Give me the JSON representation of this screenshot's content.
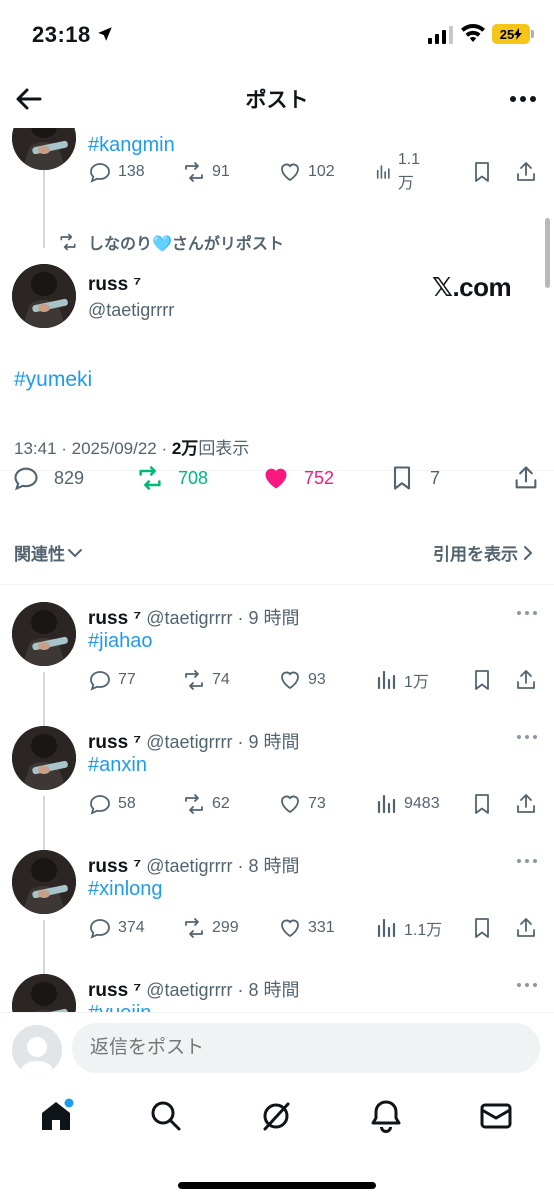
{
  "status_bar": {
    "time": "23:18",
    "battery": "25"
  },
  "header": {
    "title": "ポスト"
  },
  "top_post": {
    "hashtag": "#kangmin",
    "replies": "138",
    "reposts": "91",
    "likes": "102",
    "views": "1.1万"
  },
  "repost_notice": "しなのり🩵さんがリポスト",
  "main_post": {
    "name": "russ ⁷",
    "handle": "@taetigrrrr",
    "source": "𝕏.com",
    "hashtag": "#yumeki",
    "time": "13:41 · 2025/09/22 · ",
    "views_count": "2万",
    "views_label": "回表示",
    "replies": "829",
    "reposts": "708",
    "likes": "752",
    "bookmarks": "7"
  },
  "sort": {
    "relevance": "関連性",
    "quotes": "引用を表示"
  },
  "replies": [
    {
      "name": "russ ⁷",
      "sub": " @taetigrrrr · 9 時間",
      "hashtag": "#jiahao",
      "replies": "77",
      "reposts": "74",
      "likes": "93",
      "views": "1万"
    },
    {
      "name": "russ ⁷",
      "sub": " @taetigrrrr · 9 時間",
      "hashtag": "#anxin",
      "replies": "58",
      "reposts": "62",
      "likes": "73",
      "views": "9483"
    },
    {
      "name": "russ ⁷",
      "sub": " @taetigrrrr · 8 時間",
      "hashtag": "#xinlong",
      "replies": "374",
      "reposts": "299",
      "likes": "331",
      "views": "1.1万"
    },
    {
      "name": "russ ⁷",
      "sub": " @taetigrrrr · 8 時間",
      "hashtag": "#yuejin"
    }
  ],
  "composer": {
    "placeholder": "返信をポスト"
  },
  "colors": {
    "accent": "#1d9bf0",
    "repost_active": "#00ba7c",
    "like_active": "#f91880",
    "muted": "#536471"
  }
}
